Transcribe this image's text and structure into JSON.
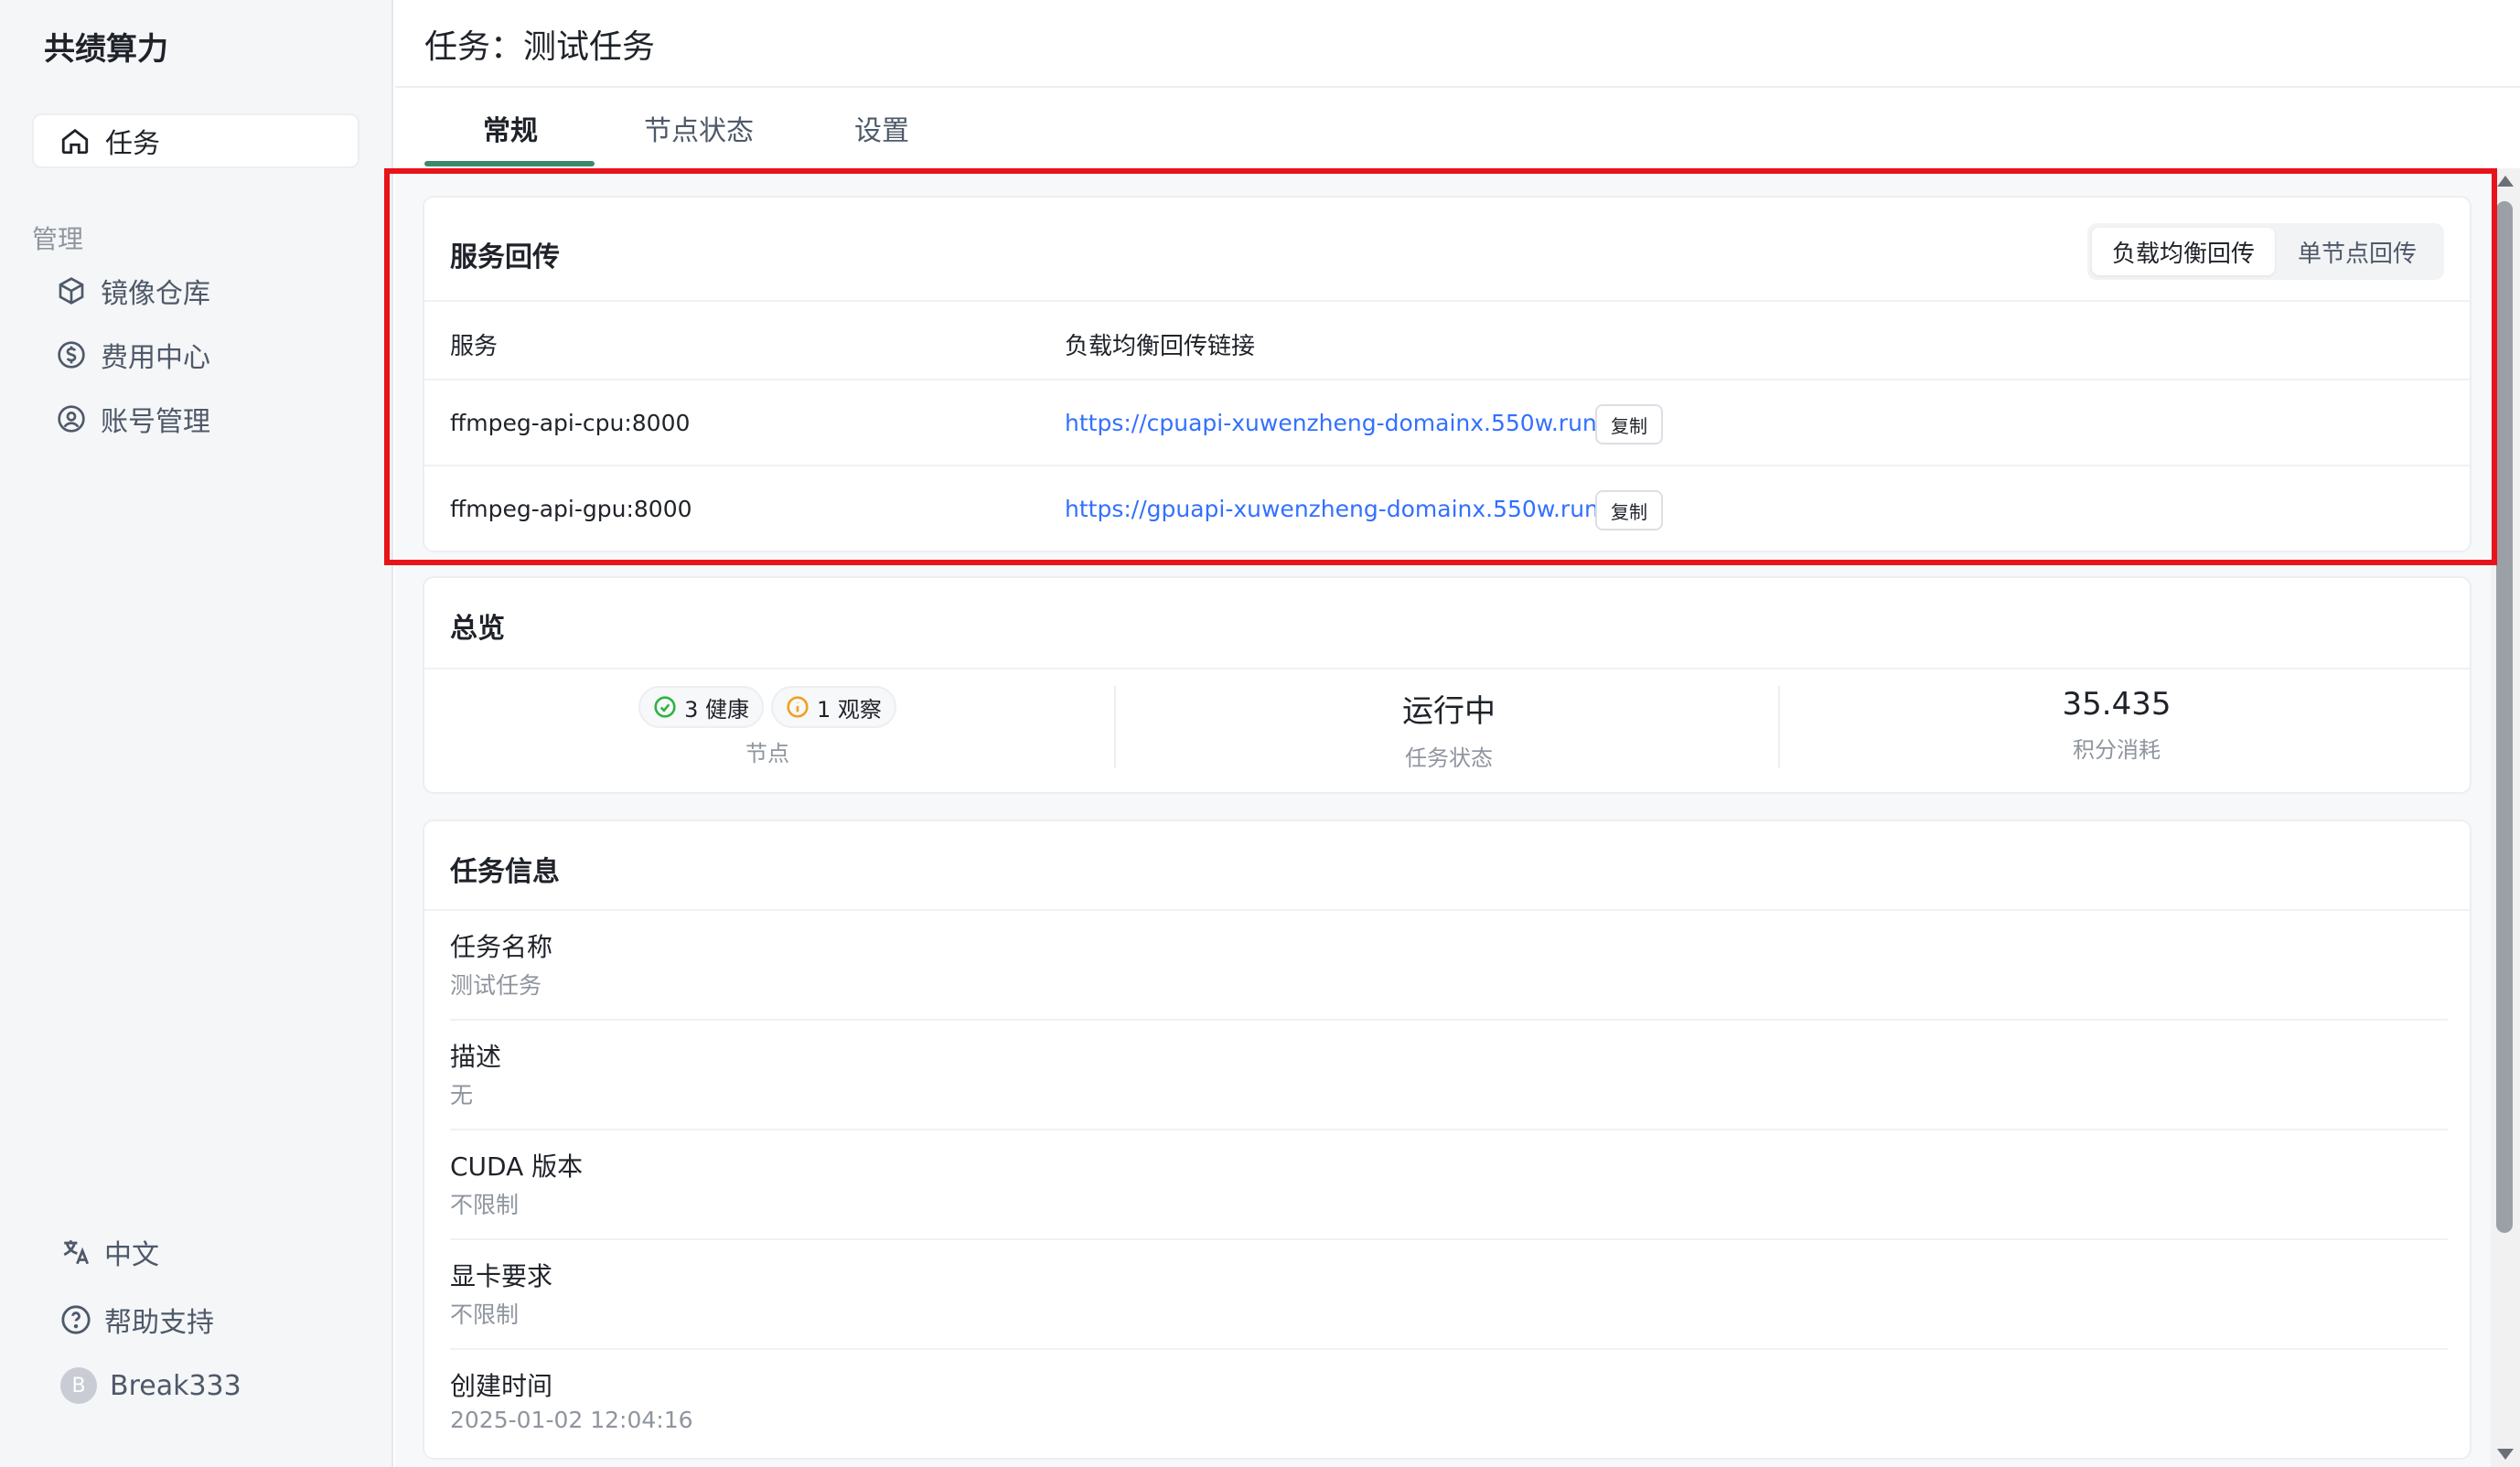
{
  "sidebar": {
    "brand": "共绩算力",
    "active_item": "任务",
    "group_label": "管理",
    "items": [
      {
        "label": "镜像仓库",
        "icon": "box-icon"
      },
      {
        "label": "费用中心",
        "icon": "dollar-icon"
      },
      {
        "label": "账号管理",
        "icon": "user-circle-icon"
      }
    ],
    "language": "中文",
    "help": "帮助支持",
    "user": {
      "initial": "B",
      "name": "Break333"
    }
  },
  "header": {
    "title": "任务：测试任务"
  },
  "tabs": [
    {
      "label": "常规",
      "active": true
    },
    {
      "label": "节点状态",
      "active": false
    },
    {
      "label": "设置",
      "active": false
    }
  ],
  "service_callback": {
    "title": "服务回传",
    "toggle": {
      "selected": "负载均衡回传",
      "other": "单节点回传"
    },
    "columns": [
      "服务",
      "负载均衡回传链接"
    ],
    "rows": [
      {
        "service": "ffmpeg-api-cpu:8000",
        "link": "https://cpuapi-xuwenzheng-domainx.550w.run",
        "copy": "复制"
      },
      {
        "service": "ffmpeg-api-gpu:8000",
        "link": "https://gpuapi-xuwenzheng-domainx.550w.run",
        "copy": "复制"
      }
    ]
  },
  "overview": {
    "title": "总览",
    "healthy_badge": "3 健康",
    "watch_badge": "1 观察",
    "nodes_label": "节点",
    "status_value": "运行中",
    "status_label": "任务状态",
    "credits_value": "35.435",
    "credits_label": "积分消耗"
  },
  "task_info": {
    "title": "任务信息",
    "fields": [
      {
        "label": "任务名称",
        "value": "测试任务"
      },
      {
        "label": "描述",
        "value": "无"
      },
      {
        "label": "CUDA 版本",
        "value": "不限制"
      },
      {
        "label": "显卡要求",
        "value": "不限制"
      },
      {
        "label": "创建时间",
        "value": "2025-01-02 12:04:16"
      }
    ]
  },
  "colors": {
    "accent": "#3d8a6b",
    "link": "#3370ff",
    "highlight": "#e8141a",
    "healthy": "#2fb344",
    "watch": "#f0a020"
  }
}
